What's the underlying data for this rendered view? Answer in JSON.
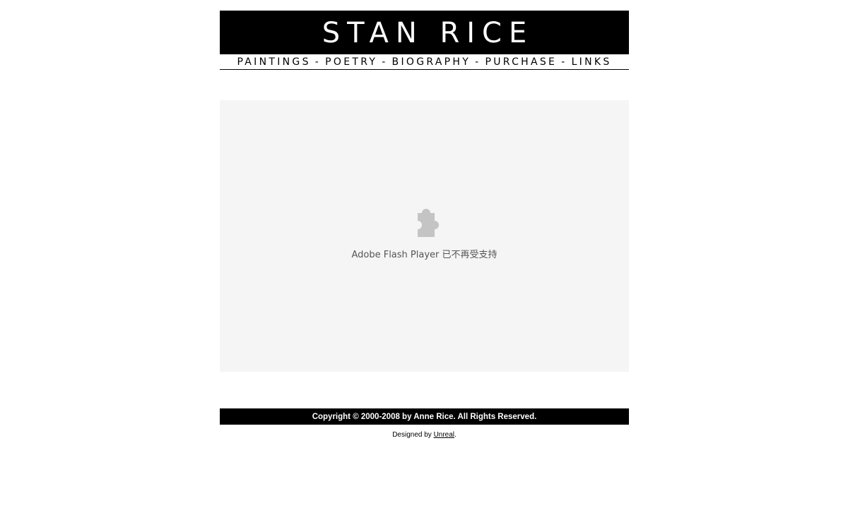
{
  "header": {
    "title": "STAN RICE"
  },
  "nav": {
    "items": [
      {
        "label": "PAINTINGS"
      },
      {
        "label": "POETRY"
      },
      {
        "label": "BIOGRAPHY"
      },
      {
        "label": "PURCHASE"
      },
      {
        "label": "LINKS"
      }
    ],
    "separator": "-"
  },
  "flash": {
    "icon": "puzzle-piece-icon",
    "message": "Adobe Flash Player 已不再受支持",
    "background": "#f5f5f5",
    "icon_color": "#c4c4c4"
  },
  "footer": {
    "copyright": "Copyright © 2000-2008 by Anne Rice.  All Rights Reserved.",
    "designed_prefix": "Designed by ",
    "designer_link": "Unreal",
    "designed_suffix": "."
  },
  "colors": {
    "banner": "#000000",
    "banner_text": "#ffffff",
    "page_background": "#ffffff"
  }
}
